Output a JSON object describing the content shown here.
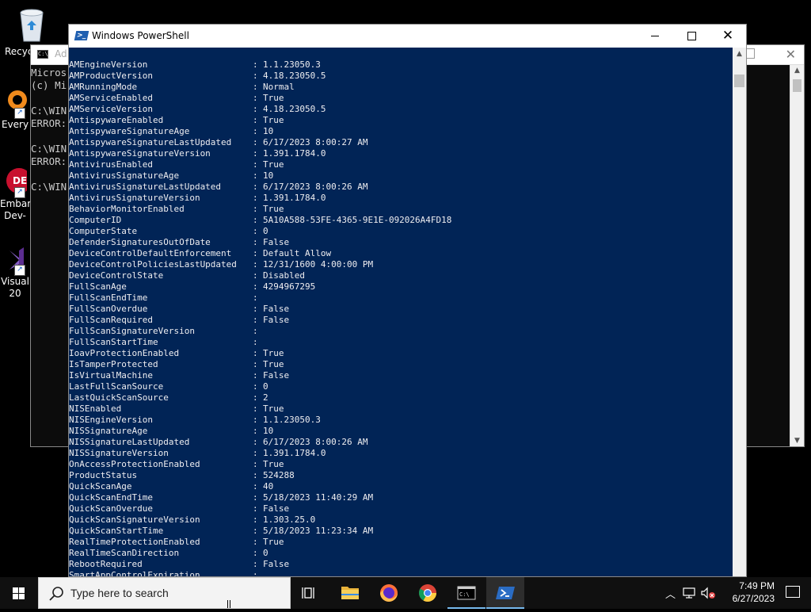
{
  "desktop": {
    "icons": [
      {
        "label": "Recycle Bin"
      },
      {
        "label": "Every"
      },
      {
        "label": "Embarc Dev-"
      },
      {
        "label": "Visual 20"
      }
    ]
  },
  "cmd_window": {
    "title": "Ad",
    "lines": [
      "Micros",
      "(c) Mi",
      "",
      "C:\\WIN",
      "ERROR:",
      "",
      "C:\\WIN",
      "ERROR:",
      "",
      "C:\\WIN"
    ]
  },
  "powershell": {
    "title": "Windows PowerShell",
    "separator": ":",
    "rows": [
      {
        "key": "AMEngineVersion",
        "value": "1.1.23050.3"
      },
      {
        "key": "AMProductVersion",
        "value": "4.18.23050.5"
      },
      {
        "key": "AMRunningMode",
        "value": "Normal"
      },
      {
        "key": "AMServiceEnabled",
        "value": "True"
      },
      {
        "key": "AMServiceVersion",
        "value": "4.18.23050.5"
      },
      {
        "key": "AntispywareEnabled",
        "value": "True"
      },
      {
        "key": "AntispywareSignatureAge",
        "value": "10"
      },
      {
        "key": "AntispywareSignatureLastUpdated",
        "value": "6/17/2023 8:00:27 AM"
      },
      {
        "key": "AntispywareSignatureVersion",
        "value": "1.391.1784.0"
      },
      {
        "key": "AntivirusEnabled",
        "value": "True"
      },
      {
        "key": "AntivirusSignatureAge",
        "value": "10"
      },
      {
        "key": "AntivirusSignatureLastUpdated",
        "value": "6/17/2023 8:00:26 AM"
      },
      {
        "key": "AntivirusSignatureVersion",
        "value": "1.391.1784.0"
      },
      {
        "key": "BehaviorMonitorEnabled",
        "value": "True"
      },
      {
        "key": "ComputerID",
        "value": "5A10A588-53FE-4365-9E1E-092026A4FD18"
      },
      {
        "key": "ComputerState",
        "value": "0"
      },
      {
        "key": "DefenderSignaturesOutOfDate",
        "value": "False"
      },
      {
        "key": "DeviceControlDefaultEnforcement",
        "value": "Default Allow"
      },
      {
        "key": "DeviceControlPoliciesLastUpdated",
        "value": "12/31/1600 4:00:00 PM"
      },
      {
        "key": "DeviceControlState",
        "value": "Disabled"
      },
      {
        "key": "FullScanAge",
        "value": "4294967295"
      },
      {
        "key": "FullScanEndTime",
        "value": ""
      },
      {
        "key": "FullScanOverdue",
        "value": "False"
      },
      {
        "key": "FullScanRequired",
        "value": "False"
      },
      {
        "key": "FullScanSignatureVersion",
        "value": ""
      },
      {
        "key": "FullScanStartTime",
        "value": ""
      },
      {
        "key": "IoavProtectionEnabled",
        "value": "True"
      },
      {
        "key": "IsTamperProtected",
        "value": "True"
      },
      {
        "key": "IsVirtualMachine",
        "value": "False"
      },
      {
        "key": "LastFullScanSource",
        "value": "0"
      },
      {
        "key": "LastQuickScanSource",
        "value": "2"
      },
      {
        "key": "NISEnabled",
        "value": "True"
      },
      {
        "key": "NISEngineVersion",
        "value": "1.1.23050.3"
      },
      {
        "key": "NISSignatureAge",
        "value": "10"
      },
      {
        "key": "NISSignatureLastUpdated",
        "value": "6/17/2023 8:00:26 AM"
      },
      {
        "key": "NISSignatureVersion",
        "value": "1.391.1784.0"
      },
      {
        "key": "OnAccessProtectionEnabled",
        "value": "True"
      },
      {
        "key": "ProductStatus",
        "value": "524288"
      },
      {
        "key": "QuickScanAge",
        "value": "40"
      },
      {
        "key": "QuickScanEndTime",
        "value": "5/18/2023 11:40:29 AM"
      },
      {
        "key": "QuickScanOverdue",
        "value": "False"
      },
      {
        "key": "QuickScanSignatureVersion",
        "value": "1.303.25.0"
      },
      {
        "key": "QuickScanStartTime",
        "value": "5/18/2023 11:23:34 AM"
      },
      {
        "key": "RealTimeProtectionEnabled",
        "value": "True"
      },
      {
        "key": "RealTimeScanDirection",
        "value": "0"
      },
      {
        "key": "RebootRequired",
        "value": "False"
      },
      {
        "key": "SmartAppControlExpiration",
        "value": ""
      }
    ]
  },
  "taskbar": {
    "search_placeholder": "Type here to search",
    "apps": [
      {
        "name": "task-view-icon"
      },
      {
        "name": "file-explorer-icon"
      },
      {
        "name": "firefox-icon"
      },
      {
        "name": "chrome-icon"
      },
      {
        "name": "command-prompt-icon"
      },
      {
        "name": "powershell-icon"
      }
    ],
    "time": "7:49 PM",
    "date": "6/27/2023"
  }
}
